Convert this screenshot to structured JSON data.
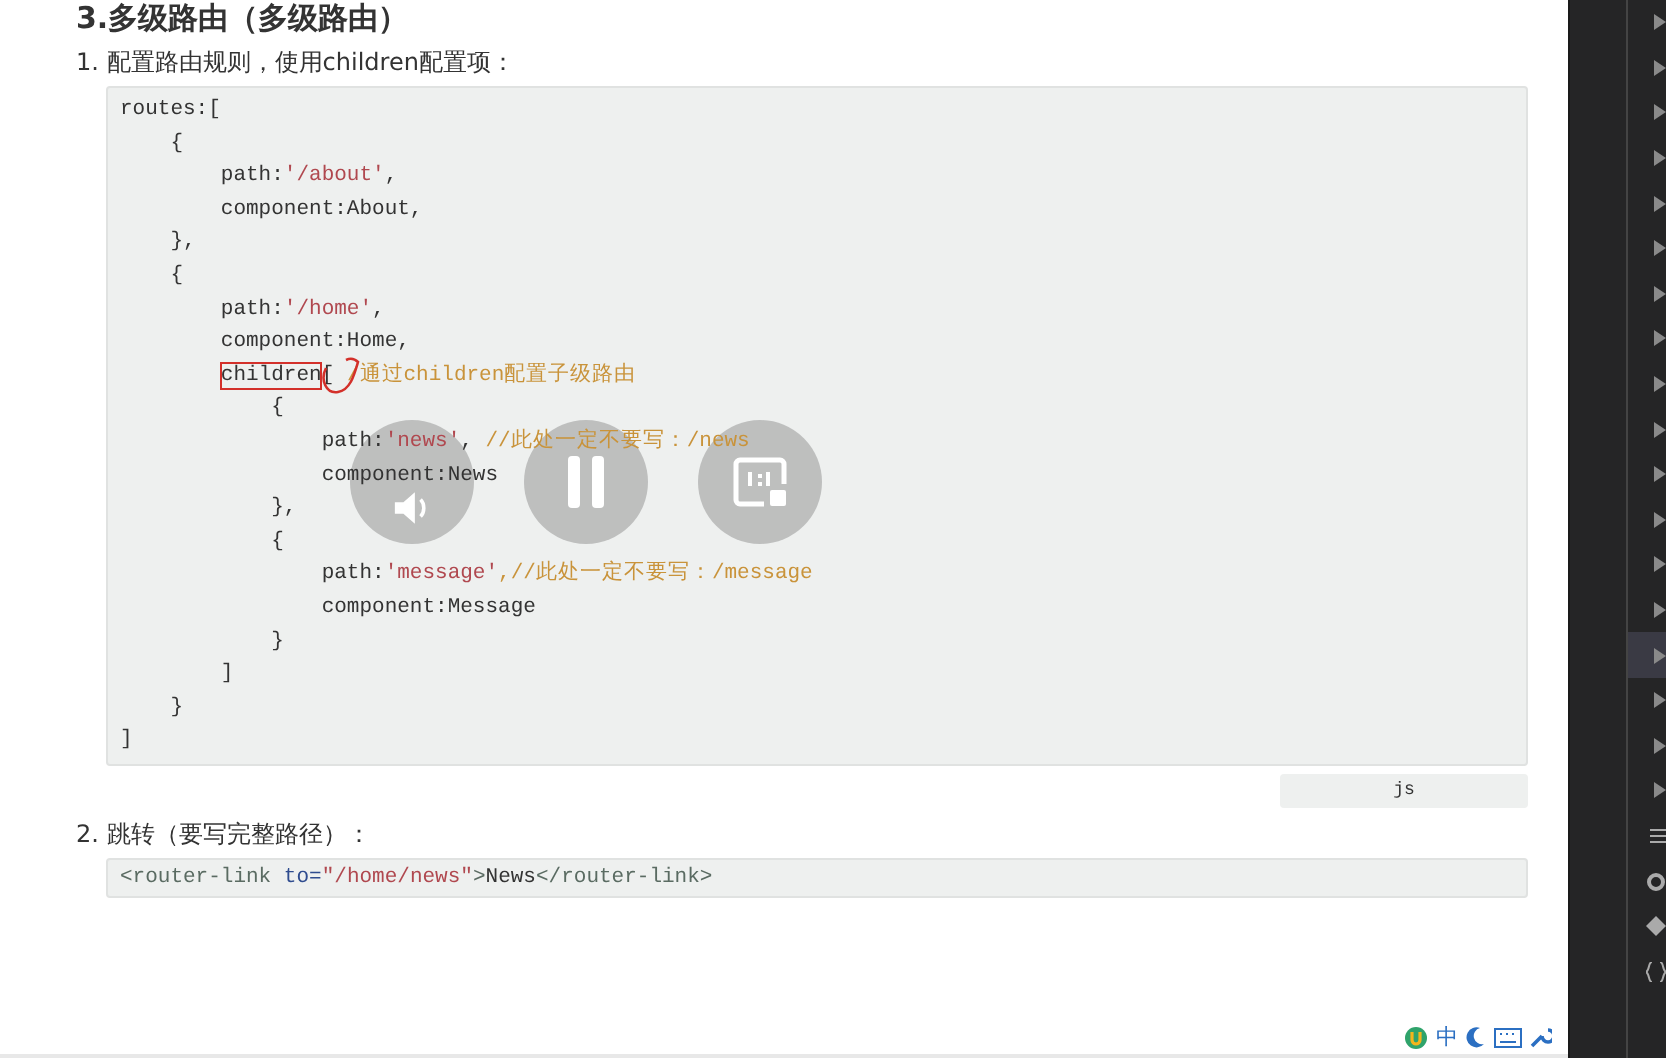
{
  "heading": "3.多级路由（多级路由）",
  "steps": [
    {
      "number": "1.",
      "text": "配置路由规则，使用children配置项：",
      "language": "js",
      "code_lines": [
        [
          {
            "text": "routes:[",
            "kind": "plain"
          }
        ],
        [
          {
            "text": "    {",
            "kind": "plain"
          }
        ],
        [
          {
            "text": "        path:",
            "kind": "plain"
          },
          {
            "text": "'/about'",
            "kind": "string"
          },
          {
            "text": ",",
            "kind": "plain"
          }
        ],
        [
          {
            "text": "        component:About,",
            "kind": "plain"
          }
        ],
        [
          {
            "text": "    },",
            "kind": "plain"
          }
        ],
        [
          {
            "text": "    {",
            "kind": "plain"
          }
        ],
        [
          {
            "text": "        path:",
            "kind": "plain"
          },
          {
            "text": "'/home'",
            "kind": "string"
          },
          {
            "text": ",",
            "kind": "plain"
          }
        ],
        [
          {
            "text": "        component:Home,",
            "kind": "plain"
          }
        ],
        [
          {
            "text": "        children",
            "kind": "plain",
            "boxed": true
          },
          {
            "text": "[ ",
            "kind": "plain",
            "circled": true
          },
          {
            "text": "/通过children配置子级路由",
            "kind": "comment"
          }
        ],
        [
          {
            "text": "            {",
            "kind": "plain"
          }
        ],
        [
          {
            "text": "                path:",
            "kind": "plain"
          },
          {
            "text": "'news'",
            "kind": "string"
          },
          {
            "text": ", ",
            "kind": "plain"
          },
          {
            "text": "//此处一定不要写：/news",
            "kind": "comment"
          }
        ],
        [
          {
            "text": "                component:News",
            "kind": "plain"
          }
        ],
        [
          {
            "text": "            },",
            "kind": "plain"
          }
        ],
        [
          {
            "text": "            {",
            "kind": "plain"
          }
        ],
        [
          {
            "text": "                path:",
            "kind": "plain"
          },
          {
            "text": "'message'",
            "kind": "string"
          },
          {
            "text": ",//此处一定不要写：/message",
            "kind": "comment"
          }
        ],
        [
          {
            "text": "                component:Message",
            "kind": "plain"
          }
        ],
        [
          {
            "text": "            }",
            "kind": "plain"
          }
        ],
        [
          {
            "text": "        ]",
            "kind": "plain"
          }
        ],
        [
          {
            "text": "    }",
            "kind": "plain"
          }
        ],
        [
          {
            "text": "]",
            "kind": "plain"
          }
        ]
      ]
    },
    {
      "number": "2.",
      "text": "跳转（要写完整路径）：",
      "code_lines": [
        [
          {
            "text": "<router-link",
            "kind": "tag"
          },
          {
            "text": " to=",
            "kind": "attr"
          },
          {
            "text": "\"/home/news\"",
            "kind": "string"
          },
          {
            "text": ">",
            "kind": "tag"
          },
          {
            "text": "News",
            "kind": "plain"
          },
          {
            "text": "</router-link>",
            "kind": "tag"
          }
        ]
      ]
    }
  ],
  "side_panel": {
    "rows": [
      {
        "selected": false
      },
      {
        "selected": false
      },
      {
        "selected": false
      },
      {
        "selected": false
      },
      {
        "selected": false
      },
      {
        "selected": false
      },
      {
        "selected": false
      },
      {
        "selected": false
      },
      {
        "selected": false
      },
      {
        "selected": false
      },
      {
        "selected": false
      },
      {
        "selected": false
      },
      {
        "selected": false
      },
      {
        "selected": false
      },
      {
        "selected": true
      },
      {
        "selected": false
      },
      {
        "selected": false
      },
      {
        "selected": false
      }
    ]
  },
  "ime_bar": {
    "label": "中"
  }
}
